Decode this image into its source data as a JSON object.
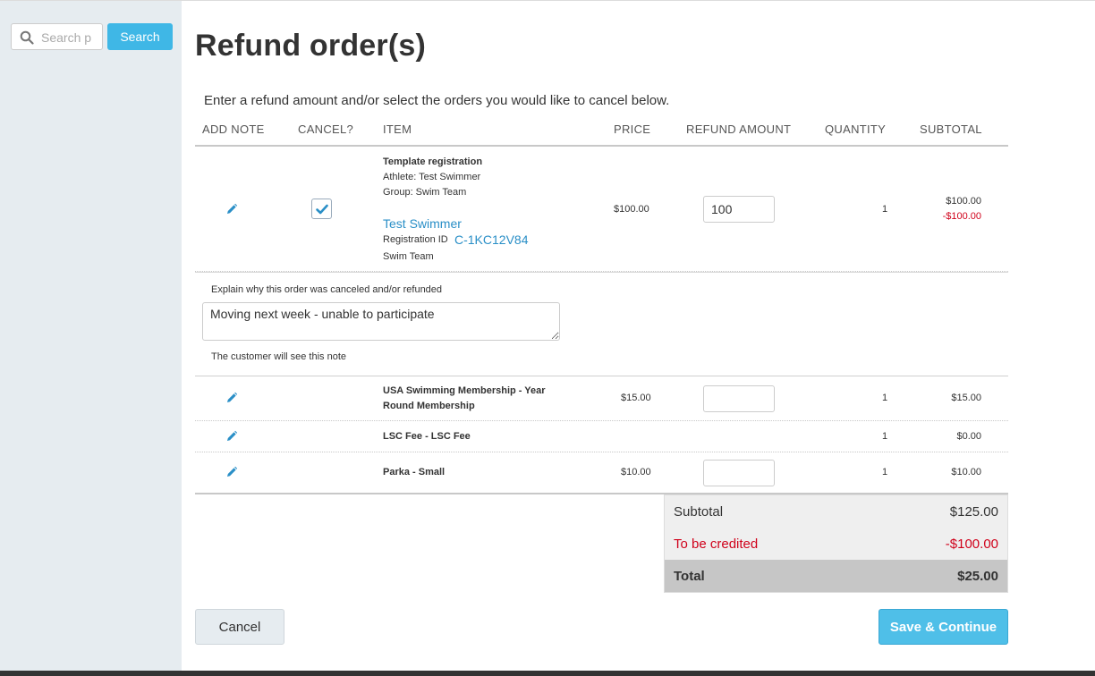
{
  "sidebar": {
    "search_placeholder": "Search p",
    "search_button": "Search"
  },
  "page": {
    "title": "Refund order(s)",
    "intro": "Enter a refund amount and/or select the orders you would like to cancel below."
  },
  "columns": [
    "ADD NOTE",
    "CANCEL?",
    "ITEM",
    "PRICE",
    "REFUND AMOUNT",
    "QUANTITY",
    "SUBTOTAL"
  ],
  "rows": [
    {
      "item": "Template registration",
      "athlete": "Athlete: Test Swimmer",
      "group": "Group: Swim Team",
      "participant_link": "Test Swimmer",
      "registration_label": "Registration ID",
      "registration_id": "C-1KC12V84",
      "team": "Swim Team",
      "price": "$100.00",
      "refund": "100",
      "quantity": "1",
      "subtotal": "$100.00",
      "credited": "-$100.00",
      "cancel_checked": true
    },
    {
      "item_line1": "USA Swimming Membership - Year",
      "item_line2": "Round Membership",
      "price": "$15.00",
      "refund": "",
      "quantity": "1",
      "subtotal": "$15.00"
    },
    {
      "item": "LSC Fee - LSC Fee",
      "price": "",
      "quantity": "1",
      "subtotal": "$0.00"
    },
    {
      "item": "Parka - Small",
      "price": "$10.00",
      "refund": "",
      "quantity": "1",
      "subtotal": "$10.00"
    }
  ],
  "note": {
    "label": "Explain why this order was canceled and/or refunded",
    "value": "Moving next week - unable to participate",
    "hint": "The customer will see this note"
  },
  "summary": {
    "subtotal_label": "Subtotal",
    "subtotal_value": "$125.00",
    "credited_label": "To be credited",
    "credited_value": "-$100.00",
    "total_label": "Total",
    "total_value": "$25.00"
  },
  "actions": {
    "cancel": "Cancel",
    "save": "Save & Continue"
  },
  "colors": {
    "accent": "#3fb7e6",
    "link": "#2a8fc7",
    "negative": "#d0021b",
    "sidebar": "#e6ecf0"
  }
}
